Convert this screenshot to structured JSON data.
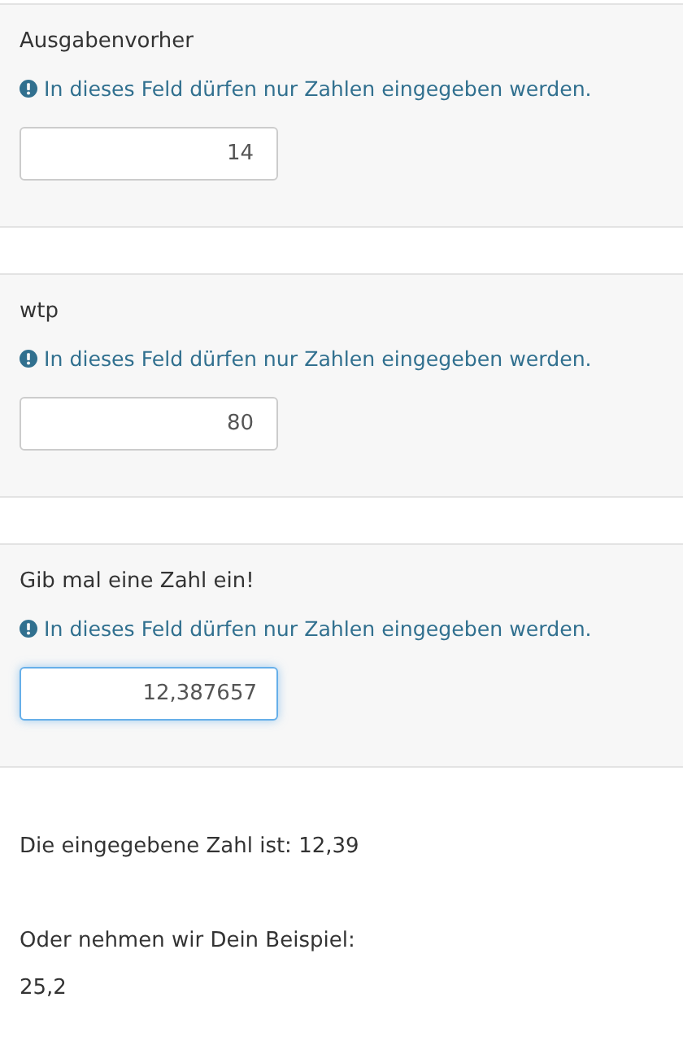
{
  "questions": [
    {
      "label": "Ausgabenvorher",
      "hint": "In dieses Feld dürfen nur Zahlen eingegeben werden.",
      "value": "14",
      "focused": false
    },
    {
      "label": "wtp",
      "hint": "In dieses Feld dürfen nur Zahlen eingegeben werden.",
      "value": "80",
      "focused": false
    },
    {
      "label": "Gib mal eine Zahl ein!",
      "hint": "In dieses Feld dürfen nur Zahlen eingegeben werden.",
      "value": "12,387657",
      "focused": true
    }
  ],
  "result": {
    "text": "Die eingegebene Zahl ist: 12,39",
    "example_label": "Oder nehmen wir Dein Beispiel:",
    "example_value": "25,2"
  }
}
